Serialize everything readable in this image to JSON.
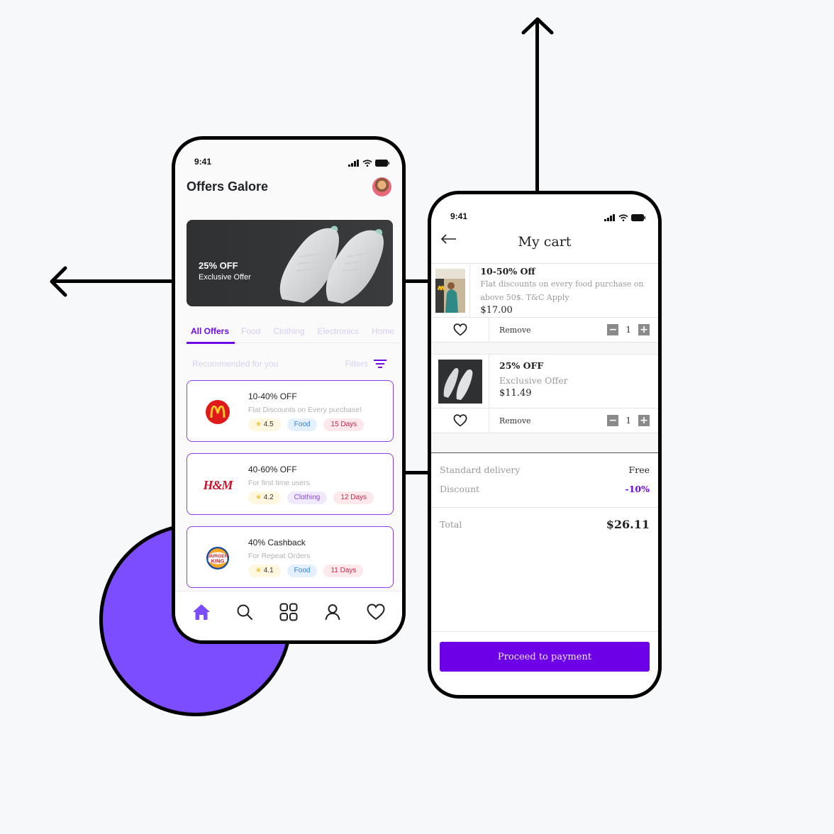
{
  "colors": {
    "accent": "#6e0ae6",
    "circle": "#7b4dff",
    "pay_button": "#6e00e8",
    "discount": "#6e0ae6"
  },
  "offers_phone": {
    "status_time": "9:41",
    "title": "Offers Galore",
    "banner": {
      "title": "25% OFF",
      "subtitle": "Exclusive Offer"
    },
    "tabs": [
      {
        "label": "All Offers",
        "active": true
      },
      {
        "label": "Food",
        "active": false
      },
      {
        "label": "Clothing",
        "active": false
      },
      {
        "label": "Electronics",
        "active": false
      },
      {
        "label": "Home",
        "active": false
      }
    ],
    "recommended_label": "Recommended for you",
    "filters_label": "Filters",
    "offers": [
      {
        "brand": "McDonald's",
        "title": "10-40% OFF",
        "description": "Flat Discounts on Every purchase!",
        "rating": "4.5",
        "category": "Food",
        "days": "15 Days"
      },
      {
        "brand": "H&M",
        "title": "40-60% OFF",
        "description": "For first time users",
        "rating": "4.2",
        "category": "Clothing",
        "days": "12 Days"
      },
      {
        "brand": "Burger King",
        "title": "40% Cashback",
        "description": "For Repeat Orders",
        "rating": "4.1",
        "category": "Food",
        "days": "11 Days"
      }
    ],
    "bottom_nav": [
      {
        "icon": "home-icon",
        "active": true
      },
      {
        "icon": "search-icon",
        "active": false
      },
      {
        "icon": "grid-icon",
        "active": false
      },
      {
        "icon": "profile-icon",
        "active": false
      },
      {
        "icon": "heart-icon",
        "active": false
      }
    ]
  },
  "cart_phone": {
    "status_time": "9:41",
    "title": "My cart",
    "items": [
      {
        "title": "10-50% Off",
        "description": "Flat discounts on every food purchase on above 50$. T&C Apply",
        "price": "$17.00",
        "remove_label": "Remove",
        "quantity": "1"
      },
      {
        "title": "25% OFF",
        "description": "Exclusive Offer",
        "price": "$11.49",
        "remove_label": "Remove",
        "quantity": "1"
      }
    ],
    "summary": {
      "delivery_label": "Standard delivery",
      "delivery_value": "Free",
      "discount_label": "Discount",
      "discount_value": "-10%",
      "total_label": "Total",
      "total_value": "$26.11"
    },
    "pay_button_label": "Proceed to payment"
  }
}
